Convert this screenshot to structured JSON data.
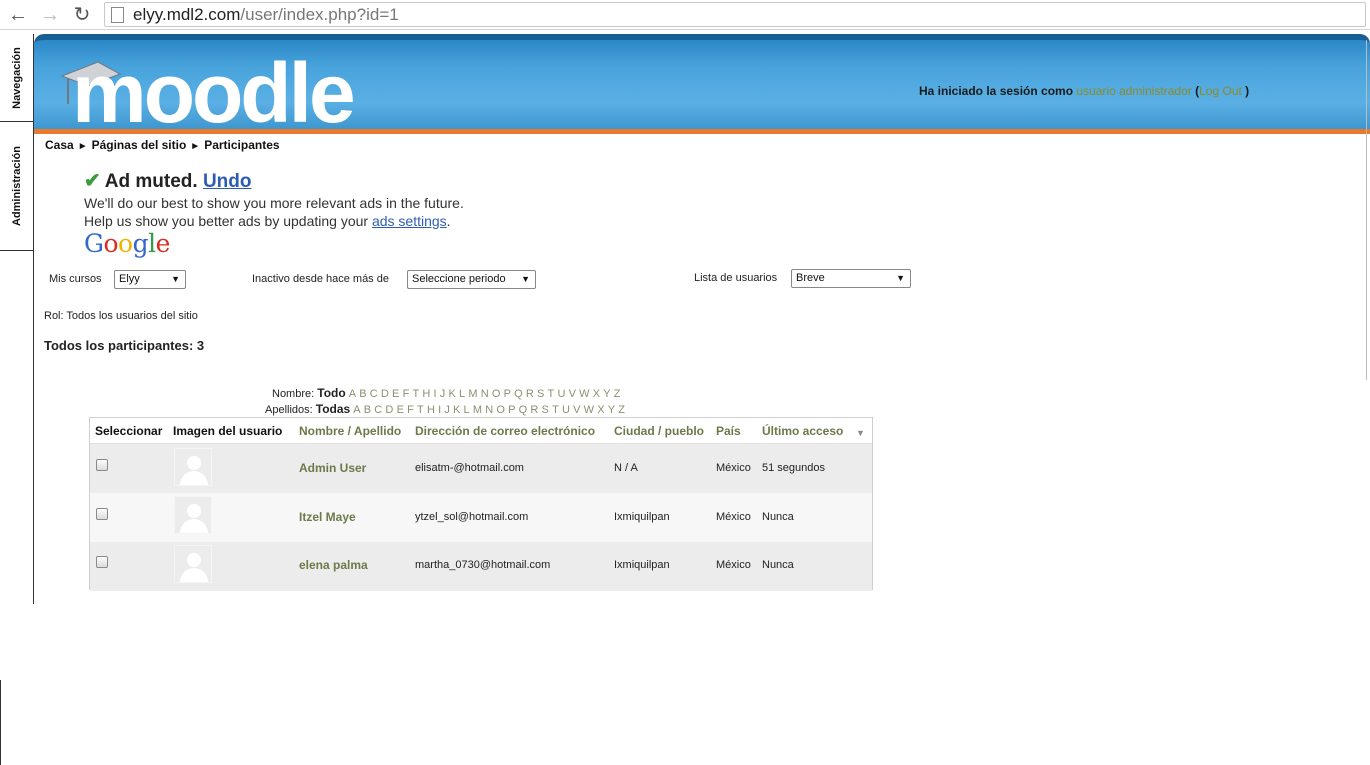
{
  "browser": {
    "url_host": "elyy.mdl2.com",
    "url_path": "/user/index.php?id=1"
  },
  "dock": {
    "tabs": [
      "Navegación",
      "Administración"
    ]
  },
  "header": {
    "logo_text": "moodle",
    "login_prefix": "Ha iniciado la sesión como",
    "login_user": "usuario administrador",
    "logout_open": "(",
    "logout": "Log Out",
    "logout_close": ")"
  },
  "breadcrumb": {
    "items": [
      "Casa",
      "Páginas del sitio",
      "Participantes"
    ],
    "separator": "►"
  },
  "ad": {
    "title": "Ad muted.",
    "undo": "Undo",
    "line1": "We'll do our best to show you more relevant ads in the future.",
    "line2_prefix": "Help us show you better ads by updating your",
    "line2_link": "ads settings",
    "line2_suffix": ".",
    "brand": "Google"
  },
  "filters": {
    "courses_label": "Mis cursos",
    "courses_value": "Elyy",
    "inactive_label": "Inactivo desde hace más de",
    "inactive_value": "Seleccione periodo",
    "list_label": "Lista de usuarios",
    "list_value": "Breve"
  },
  "role": "Rol: Todos los usuarios del sitio",
  "totals": "Todos los participantes: 3",
  "initials": {
    "first_label": "Nombre:",
    "first_all": "Todo",
    "last_label": "Apellidos:",
    "last_all": "Todas",
    "letters": [
      "A",
      "B",
      "C",
      "D",
      "E",
      "F",
      "T",
      "H",
      "I",
      "J",
      "K",
      "L",
      "M",
      "N",
      "O",
      "P",
      "Q",
      "R",
      "S",
      "T",
      "U",
      "V",
      "W",
      "X",
      "Y",
      "Z"
    ]
  },
  "table": {
    "headers": {
      "select": "Seleccionar",
      "picture": "Imagen del usuario",
      "name": "Nombre / Apellido",
      "email": "Dirección de correo electrónico",
      "city": "Ciudad / pueblo",
      "country": "País",
      "lastaccess": "Último acceso"
    },
    "rows": [
      {
        "name": "Admin User",
        "email": "elisatm-@hotmail.com",
        "city": "N / A",
        "country": "México",
        "lastaccess": "51 segundos"
      },
      {
        "name": "Itzel Maye",
        "email": "ytzel_sol@hotmail.com",
        "city": "Ixmiquilpan",
        "country": "México",
        "lastaccess": "Nunca"
      },
      {
        "name": "elena palma",
        "email": "martha_0730@hotmail.com",
        "city": "Ixmiquilpan",
        "country": "México",
        "lastaccess": "Nunca"
      }
    ]
  },
  "colors": {
    "header_blue": "#48a3dc",
    "header_orange": "#e8792d",
    "link_olive": "#6b7a4a"
  }
}
